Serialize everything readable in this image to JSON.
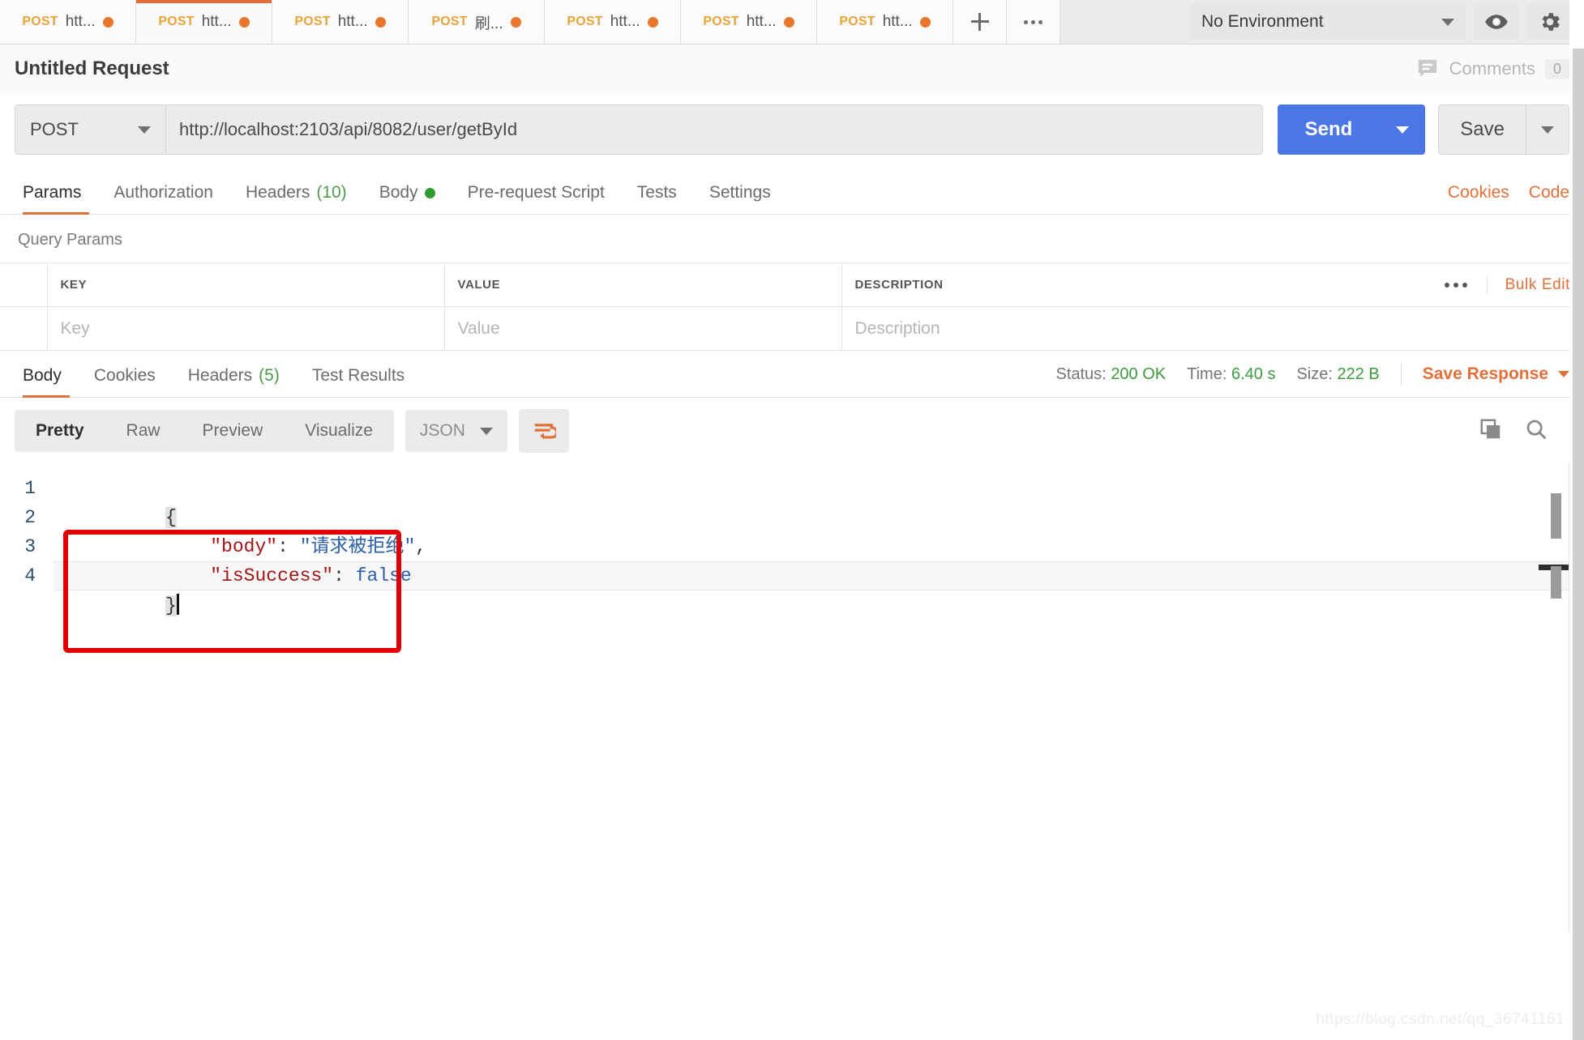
{
  "tabs": [
    {
      "method": "POST",
      "name": "htt...",
      "active": false,
      "unsaved": true
    },
    {
      "method": "POST",
      "name": "htt...",
      "active": true,
      "unsaved": true
    },
    {
      "method": "POST",
      "name": "htt...",
      "active": false,
      "unsaved": true
    },
    {
      "method": "POST",
      "name": "刷...",
      "active": false,
      "unsaved": true
    },
    {
      "method": "POST",
      "name": "htt...",
      "active": false,
      "unsaved": true
    },
    {
      "method": "POST",
      "name": "htt...",
      "active": false,
      "unsaved": true
    },
    {
      "method": "POST",
      "name": "htt...",
      "active": false,
      "unsaved": true
    }
  ],
  "tabbar": {
    "new_tab_icon": "plus-icon",
    "more_icon": "ellipsis-icon"
  },
  "environment": {
    "selected": "No Environment",
    "eye_icon": "eye-icon",
    "gear_icon": "gear-icon"
  },
  "request": {
    "title": "Untitled Request",
    "comments_label": "Comments",
    "comments_count": "0",
    "method": "POST",
    "url": "http://localhost:2103/api/8082/user/getById",
    "send_label": "Send",
    "save_label": "Save"
  },
  "request_tabs": [
    {
      "label": "Params",
      "active": true
    },
    {
      "label": "Authorization",
      "active": false
    },
    {
      "label": "Headers",
      "active": false,
      "count": "(10)"
    },
    {
      "label": "Body",
      "active": false,
      "dot": true
    },
    {
      "label": "Pre-request Script",
      "active": false
    },
    {
      "label": "Tests",
      "active": false
    },
    {
      "label": "Settings",
      "active": false
    }
  ],
  "request_tabs_right": [
    {
      "label": "Cookies"
    },
    {
      "label": "Code"
    }
  ],
  "query_params": {
    "section_label": "Query Params",
    "columns": [
      "KEY",
      "VALUE",
      "DESCRIPTION"
    ],
    "bulk_edit_label": "Bulk Edit",
    "placeholder_row": {
      "key": "Key",
      "value": "Value",
      "description": "Description"
    }
  },
  "response_tabs": [
    {
      "label": "Body",
      "active": true
    },
    {
      "label": "Cookies",
      "active": false
    },
    {
      "label": "Headers",
      "active": false,
      "count": "(5)"
    },
    {
      "label": "Test Results",
      "active": false
    }
  ],
  "response_meta": {
    "status_label": "Status:",
    "status_value": "200 OK",
    "time_label": "Time:",
    "time_value": "6.40 s",
    "size_label": "Size:",
    "size_value": "222 B",
    "save_response_label": "Save Response"
  },
  "viewer": {
    "modes": [
      {
        "label": "Pretty",
        "active": true
      },
      {
        "label": "Raw",
        "active": false
      },
      {
        "label": "Preview",
        "active": false
      },
      {
        "label": "Visualize",
        "active": false
      }
    ],
    "format": "JSON",
    "wrap_icon": "word-wrap-icon",
    "copy_icon": "copy-icon",
    "search_icon": "search-icon"
  },
  "response_body": {
    "language": "json",
    "line_numbers": [
      "1",
      "2",
      "3",
      "4"
    ],
    "lines": [
      {
        "n": "1",
        "open_brace": "{"
      },
      {
        "n": "2",
        "key": "\"body\"",
        "colon": ": ",
        "value": "\"请求被拒绝\"",
        "comma": ","
      },
      {
        "n": "3",
        "key": "\"isSuccess\"",
        "colon": ": ",
        "value": "false"
      },
      {
        "n": "4",
        "close_brace": "}"
      }
    ],
    "raw": "{\n    \"body\": \"请求被拒绝\",\n    \"isSuccess\": false\n}"
  },
  "annotation": {
    "type": "red-rectangle-highlight"
  },
  "watermark": "https://blog.csdn.net/qq_36741161",
  "colors": {
    "accent_orange": "#e2703b",
    "send_blue": "#4a77e5",
    "success_green": "#3d9b3d",
    "method_orange": "#e8a33d",
    "annotation_red": "#e10000"
  }
}
